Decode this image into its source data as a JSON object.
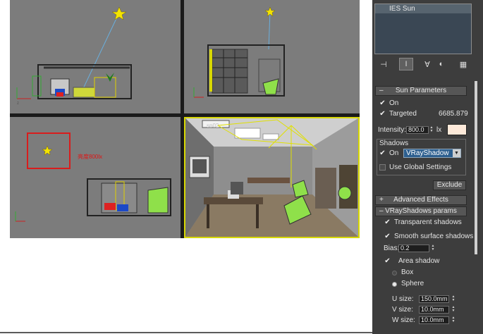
{
  "viewports": {
    "annotation_text": "亮度800lx",
    "perspective_label": "sp02"
  },
  "panel": {
    "object_list": [
      "IES Sun"
    ],
    "icons": {
      "pin": "pin-stack-icon",
      "modify": "active-modifier-icon",
      "make_unique": "make-unique-icon",
      "remove": "remove-modifier-icon",
      "configure": "configure-sets-icon"
    },
    "sun_parameters": {
      "title": "Sun Parameters",
      "on_label": "On",
      "on_checked": true,
      "targeted_label": "Targeted",
      "targeted_checked": true,
      "target_distance": "6685.879",
      "intensity_label": "Intensity:",
      "intensity_value": "800.0",
      "intensity_unit": "lx",
      "color": "#fde9d9",
      "shadows_title": "Shadows",
      "shadows_on_label": "On",
      "shadows_on_checked": true,
      "shadow_type": "VRayShadow",
      "use_global_label": "Use Global Settings",
      "use_global_checked": false,
      "exclude_label": "Exclude"
    },
    "advanced_effects": {
      "title": "Advanced Effects"
    },
    "vray_shadows": {
      "title": "VRayShadows params",
      "transparent_label": "Transparent shadows",
      "transparent_checked": true,
      "smooth_label": "Smooth surface shadows",
      "smooth_checked": true,
      "bias_label": "Bias:",
      "bias_value": "0.2",
      "area_label": "Area shadow",
      "area_checked": true,
      "box_label": "Box",
      "sphere_label": "Sphere",
      "selected_shape": "Sphere",
      "u_label": "U size:",
      "u_value": "150.0mm",
      "v_label": "V size:",
      "v_value": "10.0mm",
      "w_label": "W size:",
      "w_value": "10.0mm"
    }
  },
  "colors": {
    "panel_bg": "#3d3d3d",
    "viewport_bg": "#7c7c7c",
    "active_border": "#d8d800",
    "selection_blue": "#2d5f8f"
  }
}
